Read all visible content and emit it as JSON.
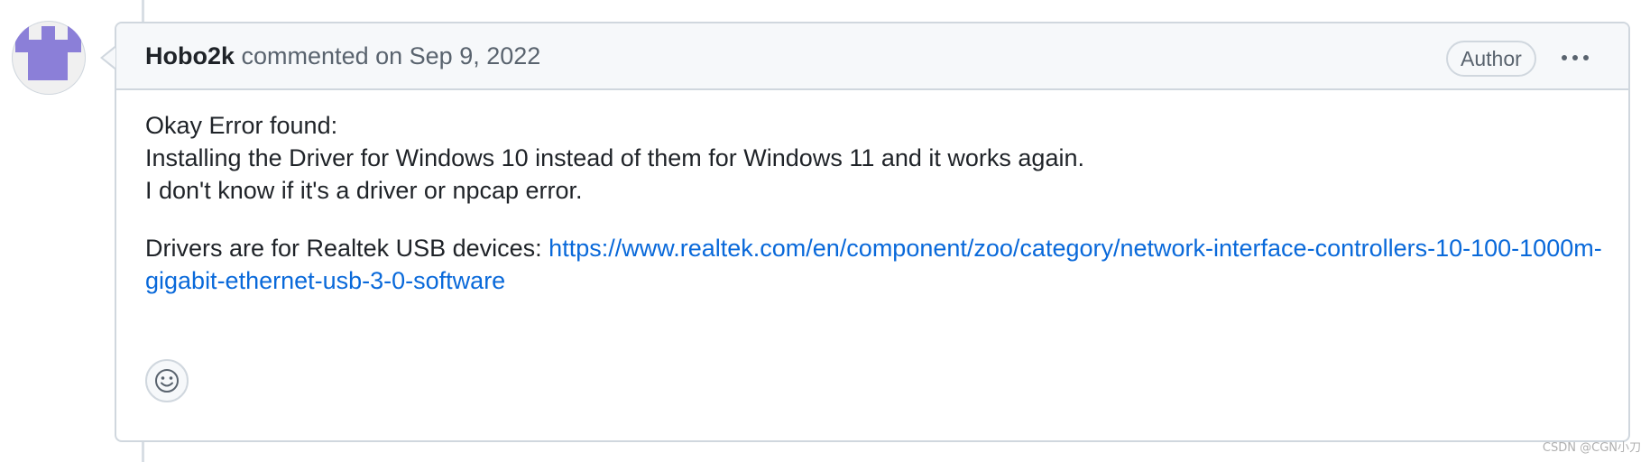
{
  "comment": {
    "author": "Hobo2k",
    "action_text": "commented on",
    "timestamp": "Sep 9, 2022",
    "badge": "Author",
    "body": {
      "line1": "Okay Error found:",
      "line2": "Installing the Driver for Windows 10 instead of them for Windows 11 and it works again.",
      "line3": "I don't know if it's a driver or npcap error.",
      "drivers_label": "Drivers are for Realtek USB devices:",
      "drivers_link": "https://www.realtek.com/en/component/zoo/category/network-interface-controllers-10-100-1000m-gigabit-ethernet-usb-3-0-software"
    }
  },
  "icons": {
    "avatar": "identicon-avatar",
    "menu": "kebab-menu-icon",
    "reaction": "smiley-icon"
  },
  "colors": {
    "avatar": "#8b7fd8",
    "link": "#0969da",
    "border": "#d0d7de",
    "header_bg": "#f6f8fa",
    "muted_text": "#59636e"
  },
  "watermark": "CSDN @CGN小刀"
}
